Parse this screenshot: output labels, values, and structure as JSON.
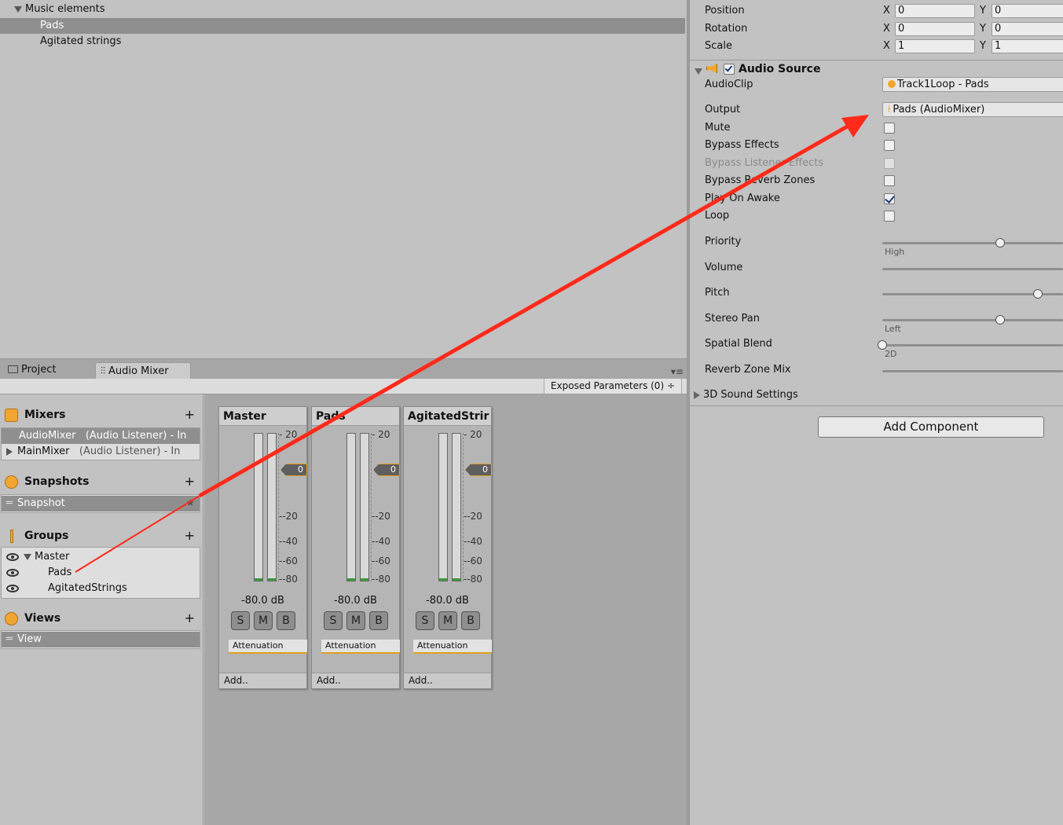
{
  "hierarchy": {
    "group_label": "Music elements",
    "items": [
      "Pads",
      "Agitated strings"
    ]
  },
  "tabs": {
    "project": "Project",
    "audio_mixer": "Audio Mixer"
  },
  "mixer_toolbar": {
    "exposed_parameters": "Exposed Parameters (0) ÷"
  },
  "mixers": {
    "title": "Mixers",
    "items": [
      {
        "name": "AudioMixer",
        "detail": "(Audio Listener) - In"
      },
      {
        "name": "MainMixer",
        "detail": "(Audio Listener) - In"
      }
    ]
  },
  "snapshots": {
    "title": "Snapshots",
    "items": [
      "Snapshot"
    ]
  },
  "groups": {
    "title": "Groups",
    "items": [
      "Master",
      "Pads",
      "AgitatedStrings"
    ]
  },
  "views": {
    "title": "Views",
    "items": [
      "View"
    ]
  },
  "strips": [
    {
      "name": "Master",
      "db": "-80.0 dB",
      "fader": "0",
      "effect": "Attenuation",
      "add": "Add.."
    },
    {
      "name": "Pads",
      "db": "-80.0 dB",
      "fader": "0",
      "effect": "Attenuation",
      "add": "Add.."
    },
    {
      "name": "AgitatedStrir",
      "db": "-80.0 dB",
      "fader": "0",
      "effect": "Attenuation",
      "add": "Add.."
    }
  ],
  "meter_ticks": [
    "20",
    "0",
    "-20",
    "-40",
    "-60",
    "-80"
  ],
  "smb": [
    "S",
    "M",
    "B"
  ],
  "inspector": {
    "transform": {
      "position": {
        "label": "Position",
        "x": "0",
        "y": "0"
      },
      "rotation": {
        "label": "Rotation",
        "x": "0",
        "y": "0"
      },
      "scale": {
        "label": "Scale",
        "x": "1",
        "y": "1"
      },
      "x_label": "X",
      "y_label": "Y"
    },
    "audio_source": {
      "title": "Audio Source",
      "audioclip_label": "AudioClip",
      "audioclip_value": "Track1Loop - Pads",
      "output_label": "Output",
      "output_value": "Pads (AudioMixer)",
      "checkboxes": [
        {
          "label": "Mute",
          "checked": false
        },
        {
          "label": "Bypass Effects",
          "checked": false
        },
        {
          "label": "Bypass Listener Effects",
          "checked": false,
          "disabled": true
        },
        {
          "label": "Bypass Reverb Zones",
          "checked": false
        },
        {
          "label": "Play On Awake",
          "checked": true
        },
        {
          "label": "Loop",
          "checked": false
        }
      ],
      "sliders": [
        {
          "label": "Priority",
          "caption": "High",
          "value": 0.65
        },
        {
          "label": "Volume",
          "value": 1.0
        },
        {
          "label": "Pitch",
          "value": 0.86
        },
        {
          "label": "Stereo Pan",
          "caption": "Left",
          "value": 0.65
        },
        {
          "label": "Spatial Blend",
          "caption": "2D",
          "value": 0.0
        },
        {
          "label": "Reverb Zone Mix",
          "value": 1.0
        }
      ],
      "sound_settings": "3D Sound Settings"
    },
    "add_component": "Add Component"
  },
  "colors": {
    "arrow": "#ff2a1a",
    "accent": "#e0a020",
    "selection": "#8f8f8f"
  }
}
